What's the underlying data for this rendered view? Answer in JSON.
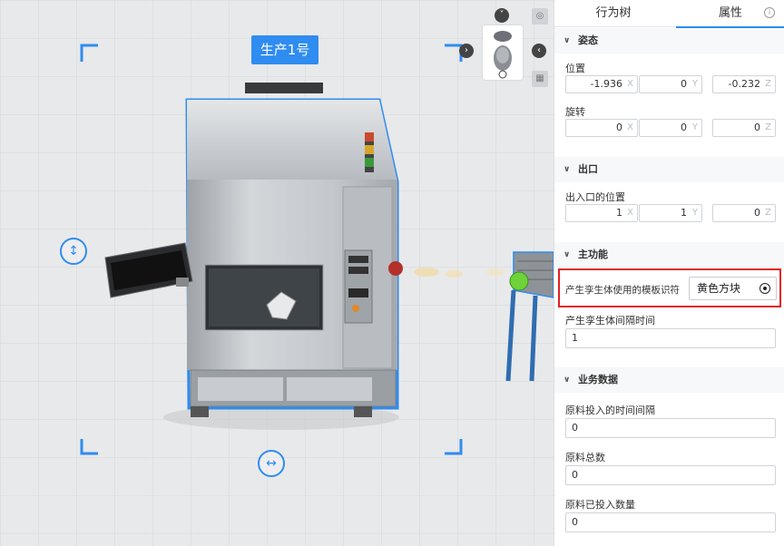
{
  "viewport": {
    "object_title": "生产1号"
  },
  "panel": {
    "tabs": [
      {
        "label": "行为树",
        "active": false
      },
      {
        "label": "属性",
        "active": true
      }
    ],
    "info_icon": "info-icon",
    "pose": {
      "title": "姿态",
      "position": {
        "label": "位置",
        "x": "-1.936",
        "y": "0",
        "z": "-0.232"
      },
      "rotation": {
        "label": "旋转",
        "x": "0",
        "y": "0",
        "z": "0"
      }
    },
    "outlet": {
      "title": "出口",
      "position": {
        "label": "出入口的位置",
        "x": "1",
        "y": "1",
        "z": "0"
      }
    },
    "main_function": {
      "title": "主功能",
      "template_label": "产生孪生体使用的模板识符",
      "template_value": "黄色方块",
      "interval_label": "产生孪生体间隔时间",
      "interval_value": "1"
    },
    "business_data": {
      "title": "业务数据",
      "feed_interval_label": "原料投入的时间间隔",
      "feed_interval_value": "0",
      "total_label": "原料总数",
      "total_value": "0",
      "fed_count_label": "原料已投入数量",
      "fed_count_value": "0"
    },
    "axes": {
      "x": "X",
      "y": "Y",
      "z": "Z"
    }
  },
  "colors": {
    "accent": "#2f8cf0",
    "highlight": "#e02020"
  }
}
